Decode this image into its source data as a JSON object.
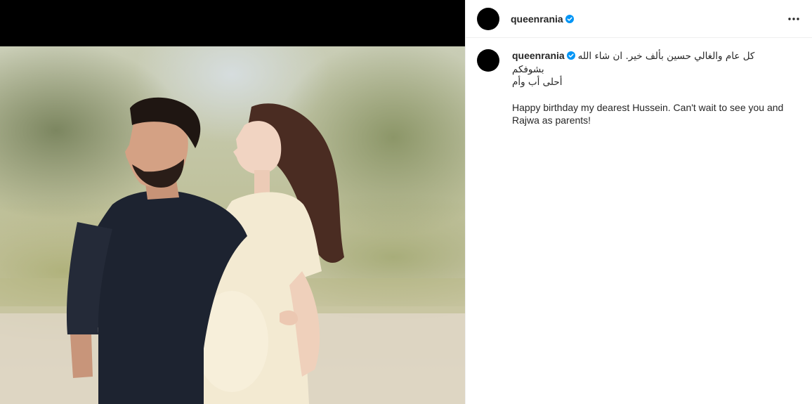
{
  "post": {
    "username": "queenrania",
    "verified": true,
    "caption_arabic_line1": "كل عام والغالي حسين بألف خير. ان شاء الله بشوفكم",
    "caption_arabic_line2": "أحلى أب وأم",
    "caption_english": "Happy birthday my dearest Hussein. Can't wait to see you and Rajwa as parents!"
  },
  "icons": {
    "verified": "verified-badge-icon",
    "more": "more-options-icon"
  },
  "colors": {
    "verified_blue": "#0095f6",
    "text": "#262626",
    "divider": "#efefef"
  }
}
